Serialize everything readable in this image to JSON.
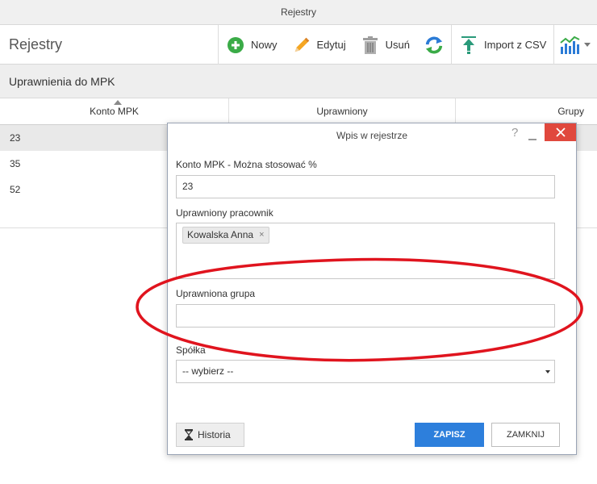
{
  "window": {
    "title": "Rejestry"
  },
  "header": {
    "page_title": "Rejestry"
  },
  "toolbar": {
    "new_label": "Nowy",
    "edit_label": "Edytuj",
    "delete_label": "Usuń",
    "import_label": "Import z CSV",
    "icons": [
      "plus-circle-icon",
      "pencil-icon",
      "trash-icon",
      "refresh-icon",
      "upload-icon",
      "chart-icon",
      "chevron-down-icon"
    ]
  },
  "section": {
    "title": "Uprawnienia do MPK"
  },
  "grid": {
    "columns": [
      "Konto MPK",
      "Uprawniony",
      "Grupy"
    ],
    "rows": [
      {
        "konto": "23"
      },
      {
        "konto": "35"
      },
      {
        "konto": "52"
      }
    ]
  },
  "modal": {
    "title": "Wpis w rejestrze",
    "help": "?",
    "konto_label": "Konto MPK - Można stosować %",
    "konto_value": "23",
    "pracownik_label": "Uprawniony pracownik",
    "pracownik_tag": "Kowalska Anna",
    "tag_remove": "×",
    "grupa_label": "Uprawniona grupa",
    "grupa_value": "",
    "spolka_label": "Spółka",
    "spolka_value": "-- wybierz --",
    "history_label": "Historia",
    "save_label": "ZAPISZ",
    "close_label": "ZAMKNIJ"
  },
  "colors": {
    "accent_blue": "#2d7fdc",
    "close_red": "#e0483d",
    "annotation_red": "#e0141e",
    "new_green": "#3aab47",
    "edit_orange": "#f5a623"
  }
}
